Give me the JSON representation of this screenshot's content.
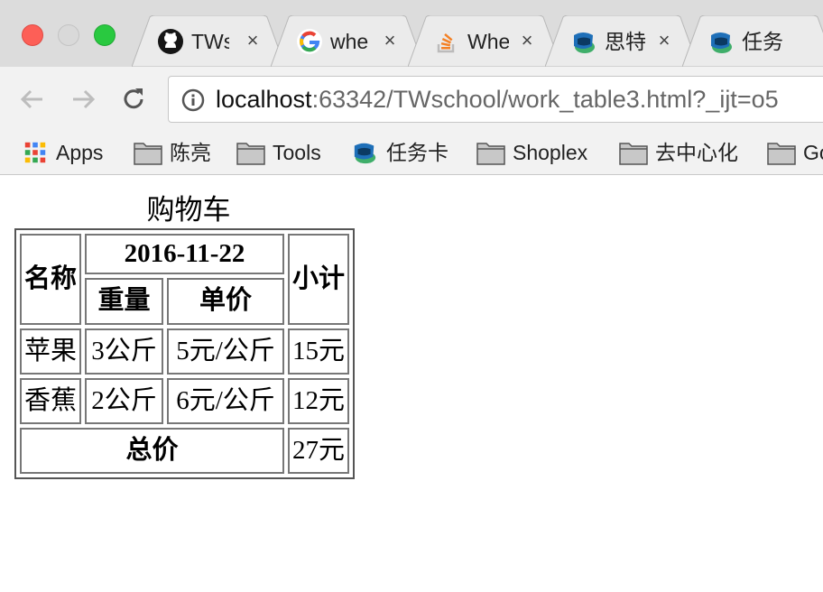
{
  "window": {
    "controls": [
      "close",
      "minimize",
      "maximize"
    ]
  },
  "tabs": [
    {
      "title": "TWs",
      "icon": "github-icon",
      "close": "×"
    },
    {
      "title": "whe",
      "icon": "google-icon",
      "close": "×"
    },
    {
      "title": "Whe",
      "icon": "stackoverflow-icon",
      "close": "×"
    },
    {
      "title": "思特",
      "icon": "thoughtworks-icon",
      "close": "×"
    },
    {
      "title": "任务",
      "icon": "thoughtworks-icon",
      "close": "×"
    }
  ],
  "toolbar": {
    "url_host": "localhost",
    "url_rest": ":63342/TWschool/work_table3.html?_ijt=o5"
  },
  "bookmarks": [
    {
      "label": "Apps",
      "icon": "apps-grid-icon"
    },
    {
      "label": "陈亮",
      "icon": "folder-icon"
    },
    {
      "label": "Tools",
      "icon": "folder-icon"
    },
    {
      "label": "任务卡",
      "icon": "thoughtworks-icon"
    },
    {
      "label": "Shoplex",
      "icon": "folder-icon"
    },
    {
      "label": "去中心化",
      "icon": "folder-icon"
    },
    {
      "label": "Go",
      "icon": "folder-icon"
    }
  ],
  "page": {
    "caption": "购物车",
    "header": {
      "name": "名称",
      "date": "2016-11-22",
      "weight": "重量",
      "unit_price": "单价",
      "subtotal": "小计"
    },
    "rows": [
      {
        "name": "苹果",
        "weight": "3公斤",
        "unit_price": "5元/公斤",
        "subtotal": "15元"
      },
      {
        "name": "香蕉",
        "weight": "2公斤",
        "unit_price": "6元/公斤",
        "subtotal": "12元"
      }
    ],
    "total": {
      "label": "总价",
      "value": "27元"
    }
  },
  "colors": {
    "close": "#fd5f57",
    "maximize": "#29c940",
    "tab_bar": "#dcdcdc",
    "toolbar": "#f2f2f2"
  }
}
